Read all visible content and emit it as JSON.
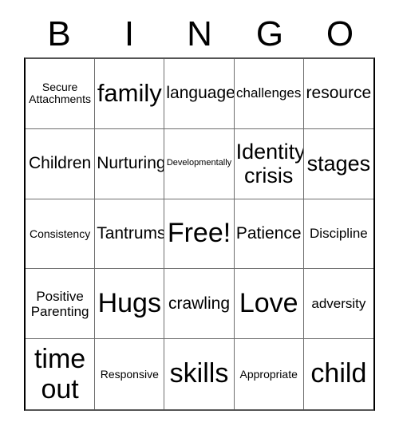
{
  "card": {
    "title": "BINGO",
    "free_space_label": "Free!",
    "header_letters": [
      "B",
      "I",
      "N",
      "G",
      "O"
    ],
    "columns": 5,
    "rows": 5,
    "border_color": "#000000",
    "grid_line_color": "#6e6e6e",
    "background_color": "#ffffff",
    "text_color": "#000000",
    "cells": [
      {
        "text": "Secure\nAttachments",
        "size": "fs-xs",
        "lines": 2
      },
      {
        "text": "family",
        "size": "fs-xl",
        "lines": 1
      },
      {
        "text": "language",
        "size": "fs-md",
        "lines": 1
      },
      {
        "text": "challenges",
        "size": "fs-sm",
        "lines": 1
      },
      {
        "text": "resource",
        "size": "fs-md",
        "lines": 1
      },
      {
        "text": "Children",
        "size": "fs-md",
        "lines": 1
      },
      {
        "text": "Nurturing",
        "size": "fs-md",
        "lines": 1
      },
      {
        "text": "Developmentally",
        "size": "fs-tiny",
        "lines": 1
      },
      {
        "text": "Identity\ncrisis",
        "size": "fs-lg",
        "lines": 2
      },
      {
        "text": "stages",
        "size": "fs-lg",
        "lines": 1
      },
      {
        "text": "Consistency",
        "size": "fs-xs",
        "lines": 1
      },
      {
        "text": "Tantrums",
        "size": "fs-md",
        "lines": 1
      },
      {
        "text": "Free!",
        "size": "fs-xxl",
        "lines": 1
      },
      {
        "text": "Patience",
        "size": "fs-md",
        "lines": 1
      },
      {
        "text": "Discipline",
        "size": "fs-sm",
        "lines": 1
      },
      {
        "text": "Positive\nParenting",
        "size": "fs-sm",
        "lines": 2
      },
      {
        "text": "Hugs",
        "size": "fs-xxl",
        "lines": 1
      },
      {
        "text": "crawling",
        "size": "fs-md",
        "lines": 1
      },
      {
        "text": "Love",
        "size": "fs-xxl",
        "lines": 1
      },
      {
        "text": "adversity",
        "size": "fs-sm",
        "lines": 1
      },
      {
        "text": "time\nout",
        "size": "fs-xxl",
        "lines": 2
      },
      {
        "text": "Responsive",
        "size": "fs-xs",
        "lines": 1
      },
      {
        "text": "skills",
        "size": "fs-xxl",
        "lines": 1
      },
      {
        "text": "Appropriate",
        "size": "fs-xs",
        "lines": 1
      },
      {
        "text": "child",
        "size": "fs-xxl",
        "lines": 1
      }
    ]
  }
}
